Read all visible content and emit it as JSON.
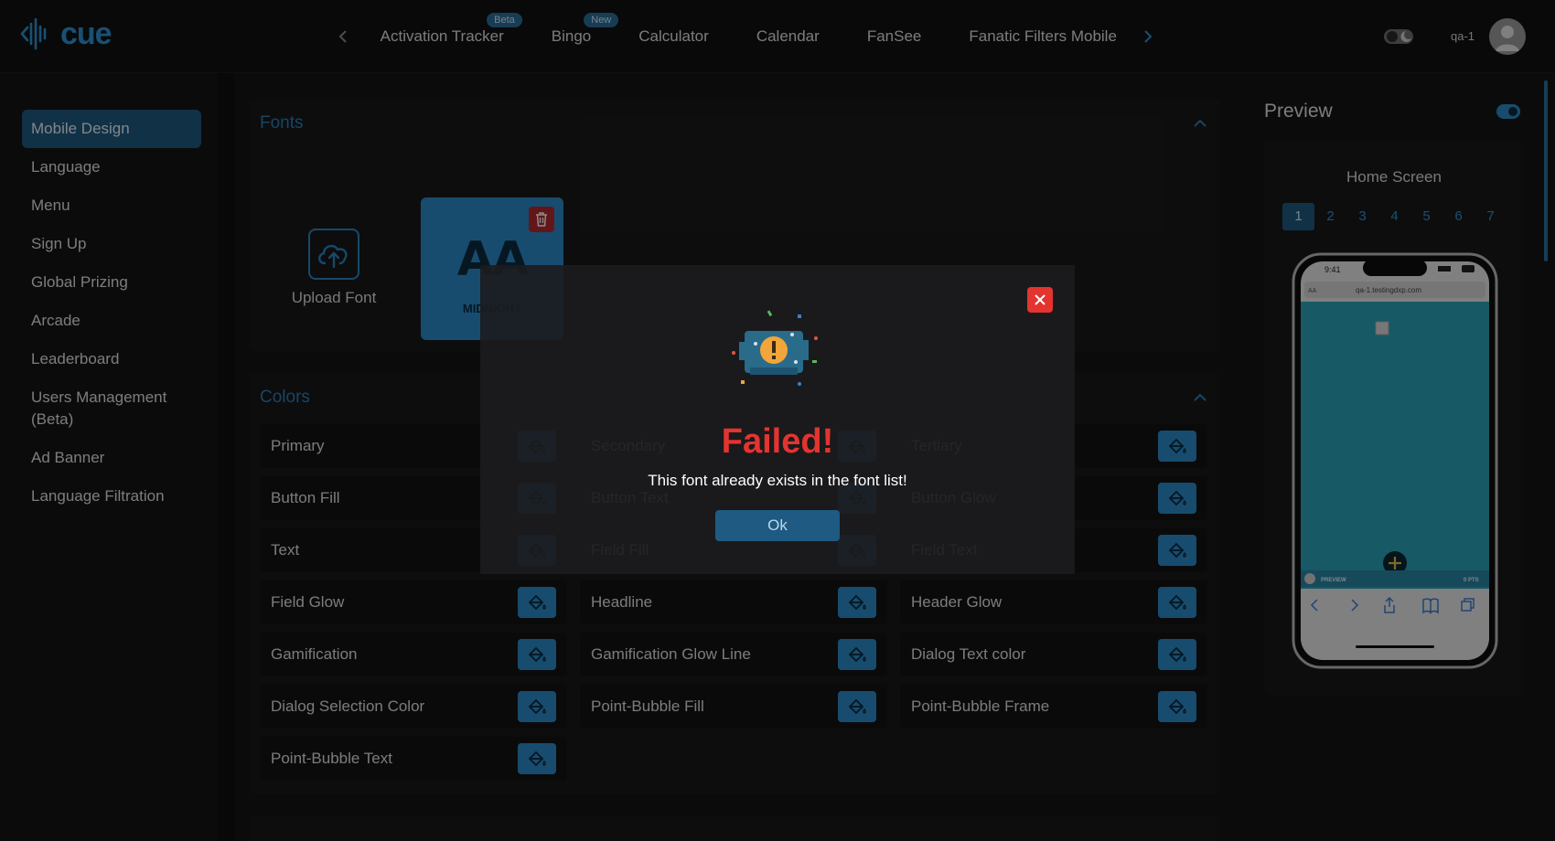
{
  "header": {
    "logo_text": "cue",
    "tabs": [
      {
        "label": "Activation Tracker",
        "badge": "Beta"
      },
      {
        "label": "Bingo",
        "badge": "New"
      },
      {
        "label": "Calculator",
        "badge": ""
      },
      {
        "label": "Calendar",
        "badge": ""
      },
      {
        "label": "FanSee",
        "badge": ""
      },
      {
        "label": "Fanatic Filters Mobile",
        "badge": ""
      }
    ],
    "user_name": "qa-1"
  },
  "sidebar": {
    "items": [
      {
        "label": "Mobile Design",
        "active": true
      },
      {
        "label": "Language"
      },
      {
        "label": "Menu"
      },
      {
        "label": "Sign Up"
      },
      {
        "label": "Global Prizing"
      },
      {
        "label": "Arcade"
      },
      {
        "label": "Leaderboard"
      },
      {
        "label": "Users Management (Beta)"
      },
      {
        "label": "Ad Banner"
      },
      {
        "label": "Language Filtration"
      }
    ]
  },
  "fonts": {
    "title": "Fonts",
    "upload_label": "Upload Font",
    "card_preview": "AA",
    "card_name": "MIDNIGHT"
  },
  "colors": {
    "title": "Colors",
    "items": [
      "Primary",
      "Secondary",
      "Tertiary",
      "Button Fill",
      "Button Text",
      "Button Glow",
      "Text",
      "Field Fill",
      "Field Text",
      "Field Glow",
      "Headline",
      "Header Glow",
      "Gamification",
      "Gamification Glow Line",
      "Dialog Text color",
      "Dialog Selection Color",
      "Point-Bubble Fill",
      "Point-Bubble Frame",
      "Point-Bubble Text"
    ]
  },
  "preview": {
    "title": "Preview",
    "screen_name": "Home Screen",
    "pages": [
      "1",
      "2",
      "3",
      "4",
      "5",
      "6",
      "7"
    ],
    "phone_time": "9:41",
    "phone_url": "qa-1.testingdxp.com",
    "phone_aa": "AA",
    "bottom_left": "PREVIEW",
    "bottom_right": "0 PTS"
  },
  "modal": {
    "title": "Failed!",
    "message": "This font already exists in the font list!",
    "ok_label": "Ok"
  },
  "colors_theme": {
    "accent": "#2b8bc9",
    "error": "#e3342f",
    "background": "#141416"
  }
}
